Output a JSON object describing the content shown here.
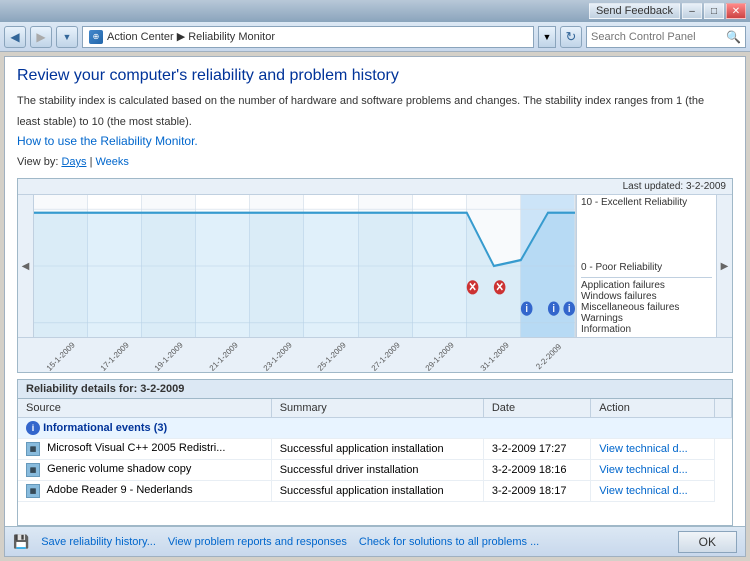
{
  "titlebar": {
    "feedback_label": "Send Feedback",
    "minimize_label": "–",
    "maximize_label": "□",
    "close_label": "✕"
  },
  "addressbar": {
    "path": "Action Center  ▶  Reliability Monitor",
    "search_placeholder": "Search Control Panel",
    "refresh_label": "↻"
  },
  "page": {
    "title": "Review your computer's reliability and problem history",
    "description_line1": "The stability index is calculated based on the number of hardware and software problems and changes. The stability index ranges from 1 (the",
    "description_line2": "least stable) to 10 (the most stable).",
    "how_to_link": "How to use the Reliability Monitor.",
    "view_by_label": "View by:",
    "view_days_link": "Days",
    "view_separator": " | ",
    "view_weeks_link": "Weeks",
    "last_updated": "Last updated: 3-2-2009",
    "reliability_high": "10 - Excellent Reliability",
    "reliability_low": "0 - Poor Reliability",
    "legend": {
      "app_failures": "Application failures",
      "windows_failures": "Windows failures",
      "misc_failures": "Miscellaneous failures",
      "warnings": "Warnings",
      "information": "Information"
    }
  },
  "chart": {
    "dates": [
      "15-1-2009",
      "17-1-2009",
      "19-1-2009",
      "21-1-2009",
      "23-1-2009",
      "25-1-2009",
      "27-1-2009",
      "29-1-2009",
      "31-1-2009",
      "2-2-2009"
    ]
  },
  "details": {
    "title_label": "Reliability details for: 3-2-2009",
    "columns": {
      "source": "Source",
      "summary": "Summary",
      "date": "Date",
      "action": "Action"
    },
    "group_label": "Informational events (3)",
    "rows": [
      {
        "source": "Microsoft Visual C++ 2005 Redistri...",
        "summary": "Successful application installation",
        "date": "3-2-2009 17:27",
        "action": "View  technical d..."
      },
      {
        "source": "Generic volume shadow copy",
        "summary": "Successful driver installation",
        "date": "3-2-2009 18:16",
        "action": "View  technical d..."
      },
      {
        "source": "Adobe Reader 9 - Nederlands",
        "summary": "Successful application installation",
        "date": "3-2-2009 18:17",
        "action": "View  technical d..."
      }
    ]
  },
  "bottombar": {
    "save_link": "Save reliability history...",
    "problems_link": "View problem reports and responses",
    "solutions_link": "Check for solutions to all problems ...",
    "ok_label": "OK"
  }
}
